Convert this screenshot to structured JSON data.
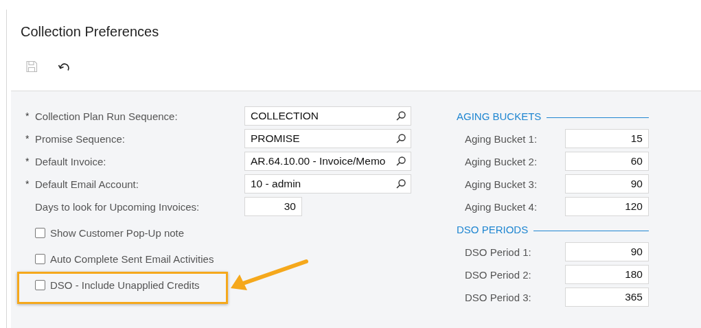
{
  "title": "Collection Preferences",
  "toolbar": [
    {
      "kind": "save",
      "disabled": true
    },
    {
      "kind": "undo",
      "disabled": false
    }
  ],
  "left_fields": [
    {
      "kind": "lookup",
      "required_mark": "*",
      "label": "Collection Plan Run Sequence:",
      "value": "COLLECTION"
    },
    {
      "kind": "lookup",
      "required_mark": "*",
      "label": "Promise Sequence:",
      "value": "PROMISE"
    },
    {
      "kind": "lookup",
      "required_mark": "*",
      "label": "Default Invoice:",
      "value": "AR.64.10.00 - Invoice/Memo"
    },
    {
      "kind": "lookup",
      "required_mark": "*",
      "label": "Default Email Account:",
      "value": "10 - admin"
    },
    {
      "kind": "number",
      "label": "Days to look for Upcoming Invoices:",
      "value": "30"
    },
    {
      "kind": "checkbox",
      "label": "Show Customer Pop-Up note",
      "checked": false,
      "highlighted": false
    },
    {
      "kind": "checkbox",
      "label": "Auto Complete Sent Email Activities",
      "checked": false,
      "highlighted": false
    },
    {
      "kind": "checkbox",
      "label": "DSO - Include Unapplied Credits",
      "checked": false,
      "highlighted": true
    }
  ],
  "sections": [
    {
      "title": "AGING BUCKETS",
      "fields": [
        {
          "label": "Aging Bucket 1:",
          "value": "15"
        },
        {
          "label": "Aging Bucket 2:",
          "value": "60"
        },
        {
          "label": "Aging Bucket 3:",
          "value": "90"
        },
        {
          "label": "Aging Bucket 4:",
          "value": "120"
        }
      ]
    },
    {
      "title": "DSO PERIODS",
      "fields": [
        {
          "label": "DSO Period 1:",
          "value": "90"
        },
        {
          "label": "DSO Period 2:",
          "value": "180"
        },
        {
          "label": "DSO Period 3:",
          "value": "365"
        }
      ]
    }
  ]
}
